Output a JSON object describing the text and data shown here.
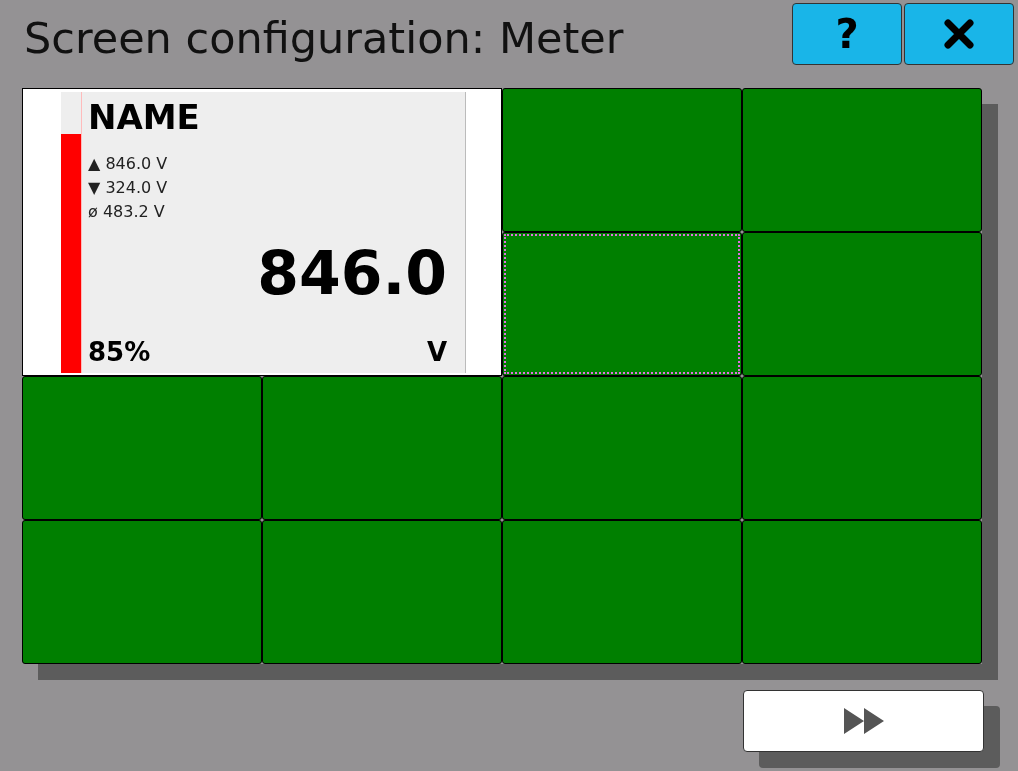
{
  "window": {
    "title": "Screen configuration: Meter"
  },
  "buttons": {
    "help": "?"
  },
  "meter": {
    "name": "NAME",
    "stats": [
      "▲ 846.0 V",
      "▼ 324.0 V",
      "ø 483.2 V"
    ],
    "value": "846.0",
    "percent": "85%",
    "unit": "V",
    "level": 0.85
  },
  "cells": [
    {
      "selected": false
    },
    {
      "selected": false
    },
    {
      "selected": true
    },
    {
      "selected": false
    },
    {
      "selected": false
    },
    {
      "selected": false
    },
    {
      "selected": false
    },
    {
      "selected": false
    },
    {
      "selected": false
    },
    {
      "selected": false
    },
    {
      "selected": false
    },
    {
      "selected": false
    }
  ]
}
